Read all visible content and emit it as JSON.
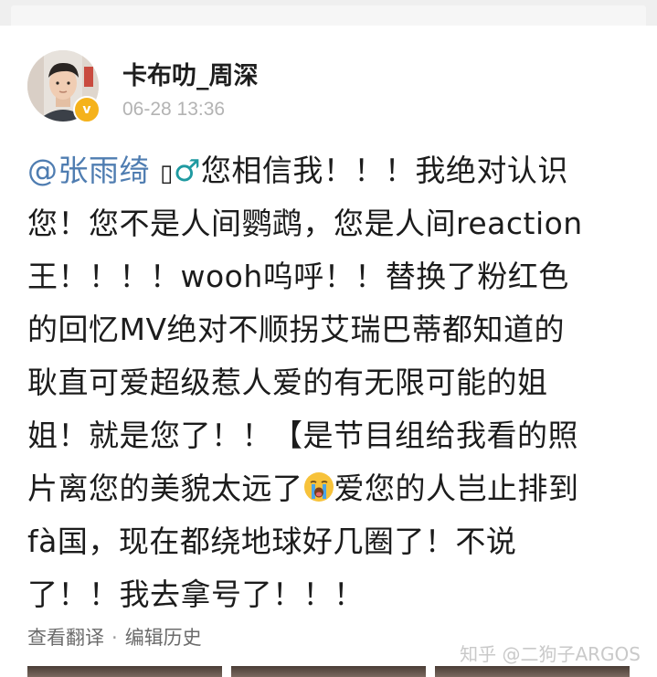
{
  "post": {
    "author": {
      "name": "卡布叻_周深",
      "verified_badge": "v"
    },
    "timestamp": "06-28 13:36",
    "body": {
      "line1": {
        "mention": "@张雨绮",
        "tofu": "▯",
        "gender_symbol": "♂",
        "text": "您相信我！！！我绝对认识"
      },
      "line2": "您！您不是人间鹦鹉，您是人间reaction",
      "line3": "王！！！！wooh呜呼！！替换了粉红色",
      "line4": "的回忆MV绝对不顺拐艾瑞巴蒂都知道的",
      "line5": "耿直可爱超级惹人爱的有无限可能的姐",
      "line6": "姐！就是您了！！【是节目组给我看的照",
      "line7": {
        "before": "片离您的美貌太远了",
        "emoji": "crying-face-icon",
        "after": "爱您的人岂止排到"
      },
      "line8": "fà国，现在都绕地球好几圈了！不说",
      "line9": "了！！我去拿号了！！！"
    },
    "footer": {
      "translate_label": "查看翻译",
      "separator": "·",
      "history_label": "编辑历史"
    }
  },
  "watermark": "知乎 @二狗子ARGOS",
  "colors": {
    "mention": "#4f7db1",
    "gender_symbol": "#1f9aa1",
    "verified_badge": "#f5b21b",
    "timestamp": "#b3b3b3",
    "body_text": "#1c1c1c"
  }
}
